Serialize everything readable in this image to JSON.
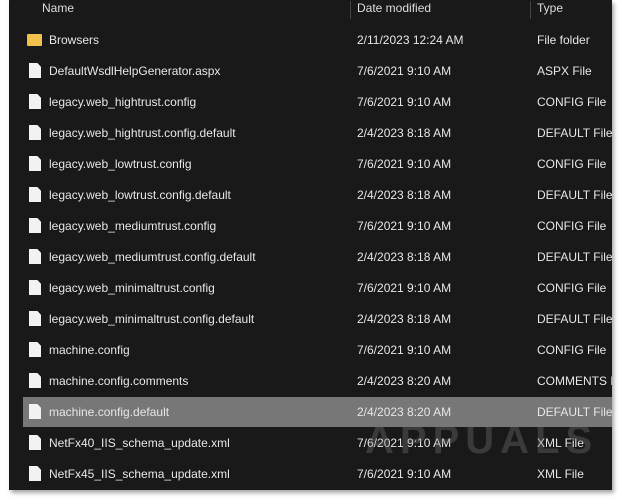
{
  "columns": {
    "name": "Name",
    "date": "Date modified",
    "type": "Type"
  },
  "watermark": "APPUALS",
  "files": [
    {
      "name": "Browsers",
      "date": "2/11/2023 12:24 AM",
      "type": "File folder",
      "icon": "folder-icon"
    },
    {
      "name": "DefaultWsdlHelpGenerator.aspx",
      "date": "7/6/2021 9:10 AM",
      "type": "ASPX File",
      "icon": "file-icon"
    },
    {
      "name": "legacy.web_hightrust.config",
      "date": "7/6/2021 9:10 AM",
      "type": "CONFIG File",
      "icon": "file-icon"
    },
    {
      "name": "legacy.web_hightrust.config.default",
      "date": "2/4/2023 8:18 AM",
      "type": "DEFAULT File",
      "icon": "file-icon"
    },
    {
      "name": "legacy.web_lowtrust.config",
      "date": "7/6/2021 9:10 AM",
      "type": "CONFIG File",
      "icon": "file-icon"
    },
    {
      "name": "legacy.web_lowtrust.config.default",
      "date": "2/4/2023 8:18 AM",
      "type": "DEFAULT File",
      "icon": "file-icon"
    },
    {
      "name": "legacy.web_mediumtrust.config",
      "date": "7/6/2021 9:10 AM",
      "type": "CONFIG File",
      "icon": "file-icon"
    },
    {
      "name": "legacy.web_mediumtrust.config.default",
      "date": "2/4/2023 8:18 AM",
      "type": "DEFAULT File",
      "icon": "file-icon"
    },
    {
      "name": "legacy.web_minimaltrust.config",
      "date": "7/6/2021 9:10 AM",
      "type": "CONFIG File",
      "icon": "file-icon"
    },
    {
      "name": "legacy.web_minimaltrust.config.default",
      "date": "2/4/2023 8:18 AM",
      "type": "DEFAULT File",
      "icon": "file-icon"
    },
    {
      "name": "machine.config",
      "date": "7/6/2021 9:10 AM",
      "type": "CONFIG File",
      "icon": "file-icon"
    },
    {
      "name": "machine.config.comments",
      "date": "2/4/2023 8:20 AM",
      "type": "COMMENTS File",
      "icon": "file-icon"
    },
    {
      "name": "machine.config.default",
      "date": "2/4/2023 8:20 AM",
      "type": "DEFAULT File",
      "icon": "file-icon",
      "selected": true
    },
    {
      "name": "NetFx40_IIS_schema_update.xml",
      "date": "7/6/2021 9:10 AM",
      "type": "XML File",
      "icon": "file-icon"
    },
    {
      "name": "NetFx45_IIS_schema_update.xml",
      "date": "7/6/2021 9:10 AM",
      "type": "XML File",
      "icon": "file-icon"
    }
  ]
}
